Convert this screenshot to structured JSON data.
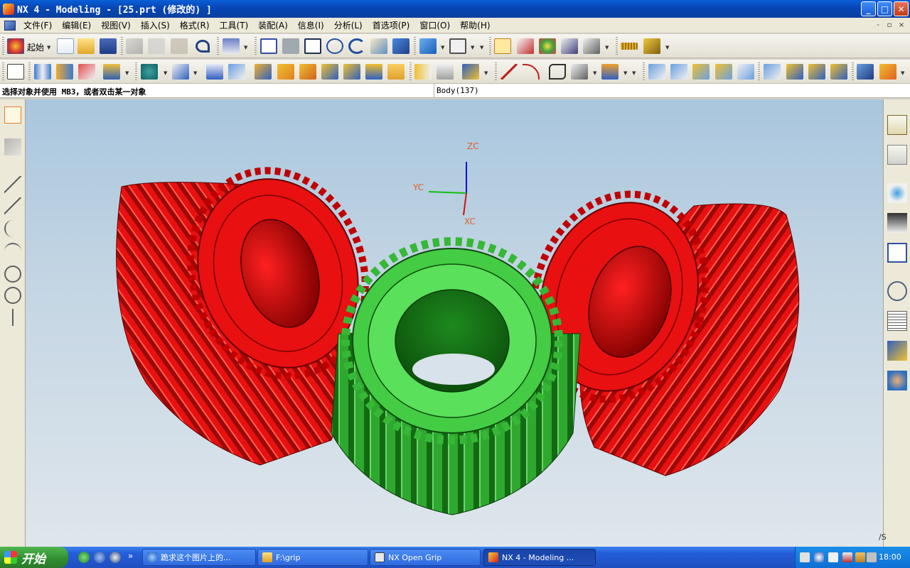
{
  "window": {
    "title": "NX 4 - Modeling - [25.prt  (修改的) ]",
    "buttons": {
      "minimize": "_",
      "maximize": "□",
      "close": "✕"
    }
  },
  "menu": {
    "items": [
      "文件(F)",
      "编辑(E)",
      "视图(V)",
      "插入(S)",
      "格式(R)",
      "工具(T)",
      "装配(A)",
      "信息(I)",
      "分析(L)",
      "首选项(P)",
      "窗口(O)",
      "帮助(H)"
    ],
    "mdi_buttons": {
      "minimize": "-",
      "restore": "▫",
      "close": "×"
    }
  },
  "toolbar": {
    "start_label": "起始"
  },
  "prompt": {
    "text": "选择对象并使用 MB3，或者双击某一对象",
    "status": "Body(137)"
  },
  "viewport": {
    "triad": {
      "z": "ZC",
      "y": "YC",
      "x": "XC"
    },
    "colors": {
      "red_gear": "#e81010",
      "green_gear": "#2ea82e",
      "axis_label": "#e0602a"
    }
  },
  "right_palette": {
    "corner_label": "/S"
  },
  "taskbar": {
    "start": "开始",
    "chevron": "»",
    "tasks": [
      {
        "label": "跪求这个图片上的...",
        "active": false
      },
      {
        "label": "F:\\grip",
        "active": false
      },
      {
        "label": "NX Open Grip",
        "active": false
      },
      {
        "label": "NX 4 - Modeling ...",
        "active": true
      }
    ],
    "clock": "18:00"
  }
}
